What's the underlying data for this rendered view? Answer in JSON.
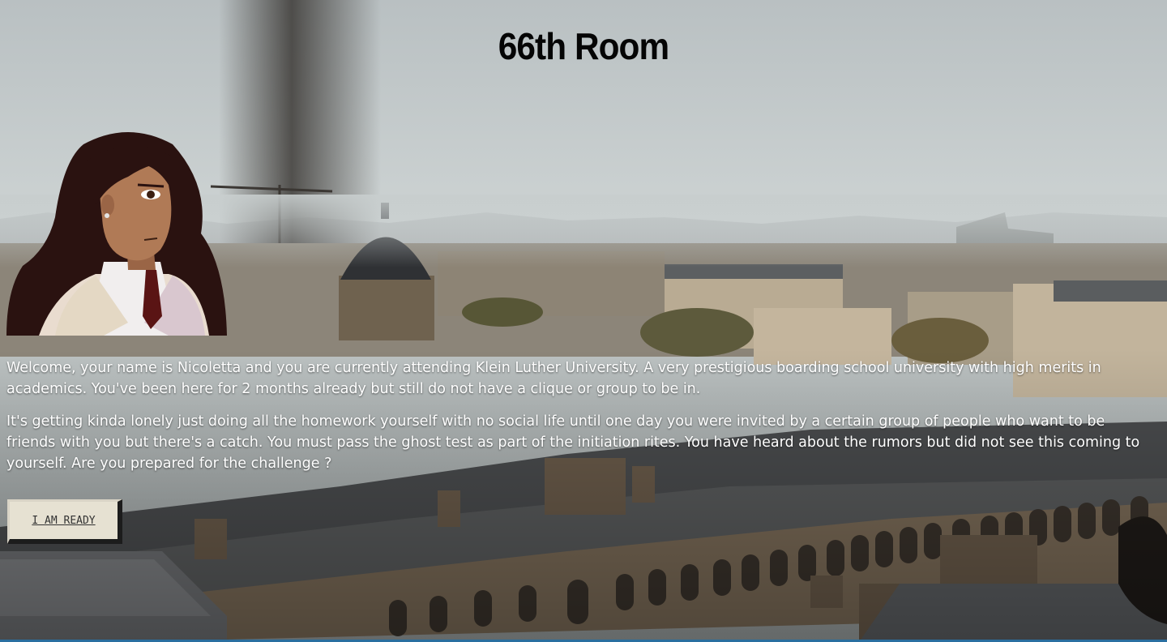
{
  "page": {
    "title": "66th Room"
  },
  "intro": {
    "paragraph_1": "Welcome, your name is Nicoletta and you are currently attending Klein Luther University. A very prestigious boarding school university with high merits in academics. You've been here for 2 months already but still do not have a clique or group to be in.",
    "paragraph_2": "It's getting kinda lonely just doing all the homework yourself with no social life until one day you were invited by a certain group of people who want to be friends with you but there's a catch. You must pass the ghost test as part of the initiation rites. You have heard about the rumors but did not see this coming to yourself. Are you prepared for the challenge ?"
  },
  "actions": {
    "ready_label": "I AM READY"
  },
  "colors": {
    "sky": "#c9cfd0",
    "roof": "#4b4d4f",
    "stone": "#7a6a57",
    "button_bg": "#e6e1d2",
    "hair": "#2a1210",
    "skin": "#a9714f"
  }
}
